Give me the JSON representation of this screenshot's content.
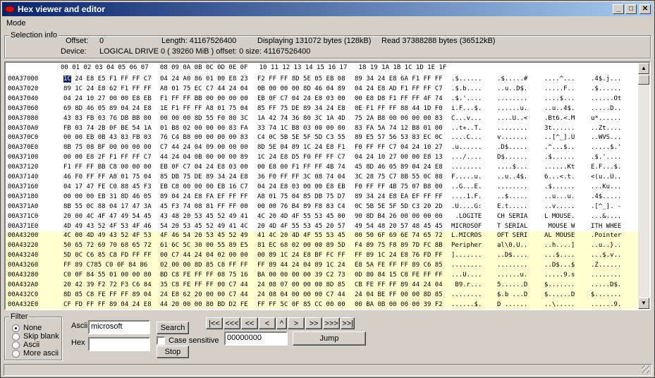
{
  "window": {
    "title": "Hex viewer and editor"
  },
  "menu": {
    "mode": "Mode"
  },
  "selection_info": {
    "group_title": "Selection info",
    "offset_label": "Offset:",
    "offset_value": "0",
    "length_label": "Length: 41167526400",
    "displaying": "Displaying 131072 bytes (128kB)",
    "read": "Read 37388288 bytes (36512kB)",
    "device_label": "Device:",
    "device_value": "LOGICAL DRIVE 0  ( 39260 MiB ) offset: 0 size: 41167526400"
  },
  "hex": {
    "header": "00 01 02 03 04 05 06 07   08 09 0A 0B 0C 0D 0E 0F   10 11 12 13 14 15 16 17   18 19 1A 1B 1C 1D 1E 1F",
    "rows": [
      {
        "addr": "00A37000",
        "g0": "1C 24 E8 E5 F1 FF FF C7",
        "g1": "04 24 A0 86 01 00 E8 23",
        "g2": "F2 FF FF 8D 5E 05 EB 08",
        "g3": "89 34 24 E8 6A F1 FF FF",
        "a0": ".$......",
        "a1": ".$.....#",
        "a2": "....^...",
        "a3": ".4$.j..."
      },
      {
        "addr": "00A37020",
        "g0": "89 1C 24 E8 62 F1 FF FF",
        "g1": "A8 01 75 EC C7 44 24 04",
        "g2": "0B 00 00 00 8D 46 04 89",
        "g3": "04 24 E8 AD F1 FF FF C7",
        "a0": ".$.b....",
        "a1": "..u..D$.",
        "a2": ".....F..",
        "a3": ".$......"
      },
      {
        "addr": "00A37040",
        "g0": "04 24 10 27 00 00 E8 EB",
        "g1": "F1 FF FF BB 00 00 00 00",
        "g2": "EB 0F C7 04 24 E8 03 00",
        "g3": "00 E8 D8 F1 FF FF 4F 74",
        "a0": ".$.'....",
        "a1": "........",
        "a2": "....$...",
        "a3": "......Ot"
      },
      {
        "addr": "00A37060",
        "g0": "69 8D 46 05 89 04 24 E8",
        "g1": "1E F1 FF FF A8 01 75 04",
        "g2": "85 FF 75 DE 89 34 24 E8",
        "g3": "0E F1 FF FF 88 44 1D F0",
        "a0": "i.F...$.",
        "a1": "......u.",
        "a2": "..u..4$.",
        "a3": ".....D.."
      },
      {
        "addr": "00A37080",
        "g0": "43 83 FB 03 76 DB BB 00",
        "g1": "00 00 00 8D 55 F0 80 3C",
        "g2": "1A 42 74 36 80 3C 1A 4D",
        "g3": "75 2A B8 00 00 00 00 83",
        "a0": "C...v...",
        "a1": "....U..<",
        "a2": ".Bt6.<.M",
        "a3": "u*......"
      },
      {
        "addr": "00A370A0",
        "g0": "FB 03 74 2B 0F BE 54 1A",
        "g1": "01 B8 02 00 00 00 83 FA",
        "g2": "33 74 1C B8 03 00 00 00",
        "g3": "83 FA 5A 74 12 B8 01 00",
        "a0": "..t+..T.",
        "a1": "........",
        "a2": "3t......",
        "a3": "..Zt...."
      },
      {
        "addr": "00A370C0",
        "g0": "00 00 EB 0B 43 83 FB 03",
        "g1": "76 C4 B8 00 00 00 00 83",
        "g2": "C4 0C 5B 5E 5F 5D C3 55",
        "g3": "89 E5 57 56 53 83 EC 0C",
        "a0": "....C...",
        "a1": "v.......",
        "a2": "..[^_].U",
        "a3": "..WVS..."
      },
      {
        "addr": "00A370E0",
        "g0": "8B 75 08 BF 00 00 00 00",
        "g1": "C7 44 24 04 09 00 00 00",
        "g2": "8D 5E 04 89 1C 24 E8 F1",
        "g3": "F0 FF FF C7 04 24 10 27",
        "a0": ".u......",
        "a1": ".D$.....",
        "a2": ".^...$..",
        "a3": ".....$.'"
      },
      {
        "addr": "00A37100",
        "g0": "00 00 E8 2F F1 FF FF C7",
        "g1": "44 24 04 0B 00 00 00 89",
        "g2": "1C 24 E8 D5 F0 FF FF C7",
        "g3": "04 24 10 27 00 00 E8 13",
        "a0": ".../....",
        "a1": "D$......",
        "a2": ".$......",
        "a3": ".$.'...."
      },
      {
        "addr": "00A37120",
        "g0": "F1 FF FF BB C8 00 00 00",
        "g1": "EB 0F C7 04 24 E8 03 00",
        "g2": "00 E8 00 F1 FF FF 4B 74",
        "g3": "45 8D 46 05 89 04 24 E8",
        "a0": "........",
        "a1": "....$...",
        "a2": "......Kt",
        "a3": "E.F...$."
      },
      {
        "addr": "00A37140",
        "g0": "46 F0 FF FF A8 01 75 04",
        "g1": "85 DB 75 DE 89 34 24 E8",
        "g2": "36 F0 FF FF 3C 08 74 04",
        "g3": "3C 28 75 C7 8B 55 0C 88",
        "a0": "F.....u.",
        "a1": "..u..4$.",
        "a2": "6...<.t.",
        "a3": "<(u..U.."
      },
      {
        "addr": "00A37160",
        "g0": "04 17 47 FE C0 88 45 F3",
        "g1": "EB C8 00 00 00 EB 16 C7",
        "g2": "04 24 E8 03 00 00 E8 EB",
        "g3": "F0 FF FF 4B 75 07 B8 00",
        "a0": "..G...E.",
        "a1": "........",
        "a2": ".$......",
        "a3": "...Ku..."
      },
      {
        "addr": "00A37180",
        "g0": "00 00 00 EB 31 8D 46 05",
        "g1": "89 04 24 E8 FA EF FF FF",
        "g2": "A8 01 75 04 85 DB 75 D7",
        "g3": "89 34 24 E8 EA EF FF FF",
        "a0": "....1.F.",
        "a1": "..$.....",
        "a2": "..u...u.",
        "a3": ".4$....."
      },
      {
        "addr": "00A371A0",
        "g0": "8B 55 0C 88 04 17 47 3A",
        "g1": "45 F3 74 08 81 FF FF 00",
        "g2": "00 00 76 B4 89 F8 83 C4",
        "g3": "0C 5B 5E 5F 5D C3 20 2D",
        "a0": ".U....G:",
        "a1": "E.t.....",
        "a2": "..v.....",
        "a3": ".[^_]. -"
      },
      {
        "addr": "00A371C0",
        "g0": "20 00 4C 4F 47 49 54 45",
        "g1": "43 48 20 53 45 52 49 41",
        "g2": "4C 20 4D 4F 55 53 45 00",
        "g3": "90 8D B4 26 00 00 00 00",
        "a0": " .LOGITE",
        "a1": "CH SERIA",
        "a2": "L MOUSE.",
        "a3": "...&...."
      },
      {
        "addr": "00A371E0",
        "g0": "4D 49 43 52 4F 53 4F 46",
        "g1": "54 20 53 45 52 49 41 4C",
        "g2": "20 4D 4F 55 53 45 20 57",
        "g3": "49 54 48 20 57 48 45 45",
        "a0": "MICROSOF",
        "a1": "T SERIAL",
        "a2": " MOUSE W",
        "a3": "ITH WHEE"
      },
      {
        "addr": "00A43200",
        "hl": true,
        "g0": "4C 00 4D 49 43 52 4F 53",
        "g1": "4F 46 54 20 53 45 52 49",
        "g2": "41 4C 20 4D 4F 55 53 45",
        "g3": "00 50 6F 69 6E 74 65 72",
        "a0": "L.MICROS",
        "a1": "OFT SERI",
        "a2": "AL MOUSE",
        "a3": ".Pointer"
      },
      {
        "addr": "00A43220",
        "hl": true,
        "g0": "50 65 72 69 70 68 65 72",
        "g1": "61 6C 5C 30 00 55 89 E5",
        "g2": "81 EC 68 02 00 00 89 5D",
        "g3": "F4 89 75 F8 89 7D FC 8B",
        "a0": "Peripher",
        "a1": "al\\0.U..",
        "a2": "..h....]",
        "a3": "..u..}.."
      },
      {
        "addr": "00A43240",
        "hl": true,
        "g0": "5D 0C C6 85 C8 FD FF FF",
        "g1": "00 C7 44 24 04 02 00 00",
        "g2": "00 89 1C 24 E8 BF FC FF",
        "g3": "FF 89 1C 24 E8 76 FD FF",
        "a0": "].......",
        "a1": "..D$....",
        "a2": "...$....",
        "a3": "...$.v.."
      },
      {
        "addr": "00A43260",
        "hl": true,
        "g0": "FF 89 C785 C0 0F 84 86",
        "g1": "02 00 00 8D 85 C8 FF FF",
        "g2": "FF 89 44 24 04 89 1C 24",
        "g3": "E8 5A FE FF FF 89 C6 85",
        "a0": "........",
        "a1": "........",
        "a2": "..D$...$",
        "a3": ".Z......"
      },
      {
        "addr": "00A43280",
        "hl": true,
        "g0": "C0 0F 84 55 01 00 00 80",
        "g1": "BD C8 FE FF FF 08 75 16",
        "g2": "BA 00 00 00 00 39 C2 73",
        "g3": "0D 80 84 15 C8 FE FF FF",
        "a0": "...U....",
        "a1": "......u.",
        "a2": ".....9.s",
        "a3": "........"
      },
      {
        "addr": "00A432A0",
        "hl": true,
        "g0": "20 42 39 F2 72 F3 C6 84",
        "g1": "35 C8 FE FF FF 00 C7 44",
        "g2": "24 08 07 00 00 00 8D 85",
        "g3": "CB FE FF FF 89 44 24 04",
        "a0": " B9.r...",
        "a1": "5......D",
        "a2": "$.......",
        "a3": ".....D$."
      },
      {
        "addr": "00A432C0",
        "hl": true,
        "g0": "8D 85 C8 FE FF FF 89 04",
        "g1": "24 E8 62 20 00 00 C7 44",
        "g2": "24 08 04 00 00 00 C7 44",
        "g3": "24 04 BE FF 00 00 8D 85",
        "a0": "........",
        "a1": "$.b ...D",
        "a2": "$......D",
        "a3": "$......."
      },
      {
        "addr": "00A432E0",
        "hl": true,
        "g0": "CF FD FF FF 89 04 24 E8",
        "g1": "44 20 00 00 80 BD D2 FE",
        "g2": "FF FF 5C 0F 85 CC 00 00",
        "g3": "00 BA 0B 00 00 00 39 F2",
        "a0": "......$.",
        "a1": "D ......",
        "a2": "..\\.....",
        "a3": "......9."
      }
    ]
  },
  "filter": {
    "title": "Filter",
    "options": [
      "None",
      "Skip blank",
      "Ascii",
      "More ascii"
    ],
    "selected": "None"
  },
  "search": {
    "ascii_label": "Ascii",
    "ascii_value": "microsoft",
    "hex_label": "Hex",
    "hex_value": "",
    "search_button": "Search",
    "case_label": "Case sensitive",
    "stop_button": "Stop"
  },
  "nav": {
    "buttons": [
      "|<<",
      "<<<",
      "<<",
      "<",
      "^",
      ">",
      ">>",
      ">>>",
      ">>|"
    ],
    "jump_value": "00000000",
    "jump_button": "Jump"
  }
}
